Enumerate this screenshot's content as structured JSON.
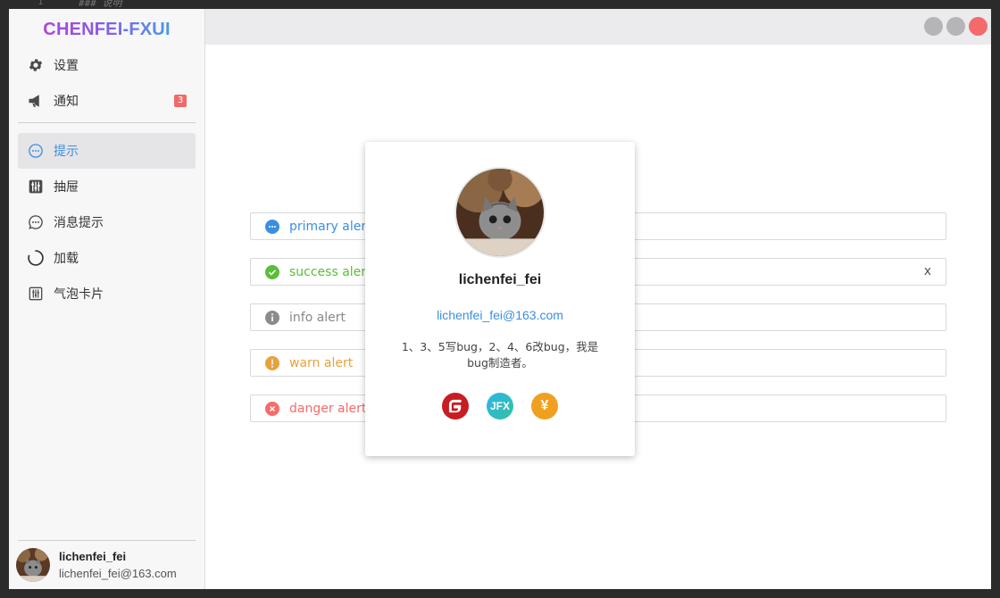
{
  "background_editor": {
    "line_number": "1",
    "code": "### 说明"
  },
  "app": {
    "logo": "CHENFEI-FXUI"
  },
  "sidebar": {
    "top_items": [
      {
        "label": "设置",
        "icon": "gear-icon"
      },
      {
        "label": "通知",
        "icon": "megaphone-icon",
        "badge": "3"
      }
    ],
    "items": [
      {
        "label": "提示",
        "icon": "chat-bubble-icon",
        "active": true
      },
      {
        "label": "抽屉",
        "icon": "sliders-icon"
      },
      {
        "label": "消息提示",
        "icon": "message-icon"
      },
      {
        "label": "加载",
        "icon": "loading-icon"
      },
      {
        "label": "气泡卡片",
        "icon": "sliders-box-icon"
      }
    ],
    "user": {
      "name": "lichenfei_fei",
      "email": "lichenfei_fei@163.com"
    }
  },
  "alerts": [
    {
      "type": "primary",
      "text": "primary alert",
      "color": "#3b8fe0"
    },
    {
      "type": "success",
      "text": "success alert",
      "color": "#5bbd3a",
      "closable": true,
      "close_label": "x"
    },
    {
      "type": "info",
      "text": "info alert",
      "color": "#888888"
    },
    {
      "type": "warn",
      "text": "warn alert",
      "color": "#e6a23c"
    },
    {
      "type": "danger",
      "text": "danger alert",
      "color": "#f56c6c"
    }
  ],
  "card": {
    "name": "lichenfei_fei",
    "email": "lichenfei_fei@163.com",
    "description": "1、3、5写bug，2、4、6改bug，我是bug制造者。",
    "links": [
      {
        "icon": "gitee-icon",
        "color": "#c71d23"
      },
      {
        "icon": "jfx-icon",
        "label": "JFX",
        "color": "#29a8c9"
      },
      {
        "icon": "yuan-icon",
        "label": "¥",
        "color": "#f0a020"
      }
    ]
  },
  "colors": {
    "accent": "#3b8fe0",
    "badge": "#f06a6a",
    "close": "#f46a6a"
  }
}
